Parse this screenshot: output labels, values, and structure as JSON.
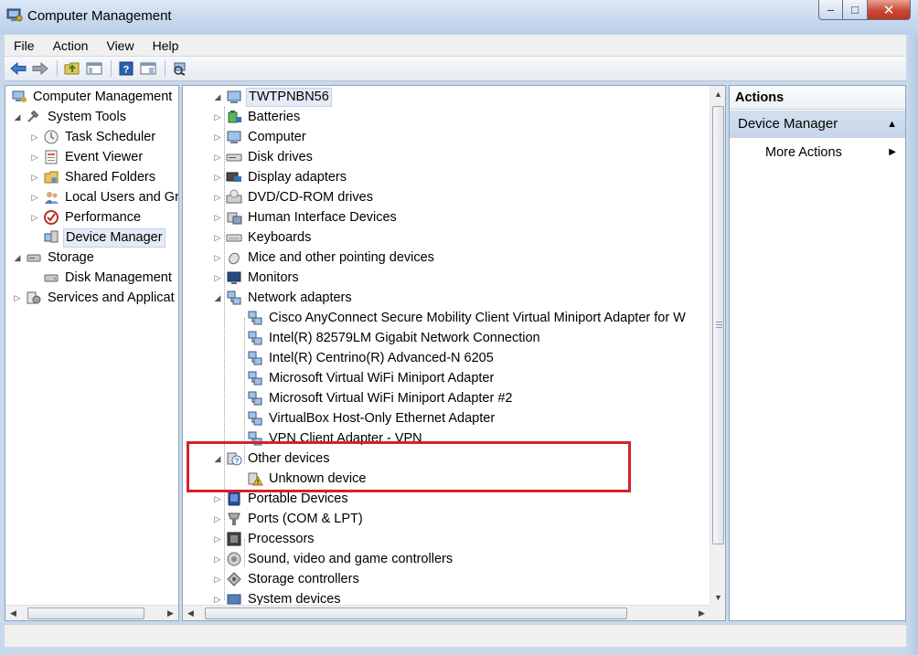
{
  "window": {
    "title": "Computer Management",
    "controls": {
      "minimize": "–",
      "maximize": "□",
      "close": "✕"
    }
  },
  "menu": [
    "File",
    "Action",
    "View",
    "Help"
  ],
  "toolbar": [
    "back-icon",
    "forward-icon",
    "up-folder-icon",
    "show-hide-tree-icon",
    "help-icon",
    "properties-icon",
    "scan-hardware-icon"
  ],
  "left_tree": [
    {
      "label": "Computer Management",
      "level": 0,
      "toggle": "",
      "icon": "computer-management-icon"
    },
    {
      "label": "System Tools",
      "level": 1,
      "toggle": "◢",
      "icon": "system-tools-icon"
    },
    {
      "label": "Task Scheduler",
      "level": 2,
      "toggle": "▷",
      "icon": "clock-icon"
    },
    {
      "label": "Event Viewer",
      "level": 2,
      "toggle": "▷",
      "icon": "event-viewer-icon"
    },
    {
      "label": "Shared Folders",
      "level": 2,
      "toggle": "▷",
      "icon": "shared-folder-icon"
    },
    {
      "label": "Local Users and Gr",
      "level": 2,
      "toggle": "▷",
      "icon": "users-icon"
    },
    {
      "label": "Performance",
      "level": 2,
      "toggle": "▷",
      "icon": "performance-icon"
    },
    {
      "label": "Device Manager",
      "level": 2,
      "toggle": "",
      "icon": "device-manager-icon",
      "selected": true
    },
    {
      "label": "Storage",
      "level": 1,
      "toggle": "◢",
      "icon": "storage-icon"
    },
    {
      "label": "Disk Management",
      "level": 2,
      "toggle": "",
      "icon": "disk-icon"
    },
    {
      "label": "Services and Applicat",
      "level": 1,
      "toggle": "▷",
      "icon": "services-icon"
    }
  ],
  "device_tree": {
    "root": "TWTPNBN56",
    "items": [
      {
        "label": "Batteries",
        "level": 1,
        "toggle": "▷",
        "icon": "battery-icon"
      },
      {
        "label": "Computer",
        "level": 1,
        "toggle": "▷",
        "icon": "computer-icon"
      },
      {
        "label": "Disk drives",
        "level": 1,
        "toggle": "▷",
        "icon": "disk-drive-icon"
      },
      {
        "label": "Display adapters",
        "level": 1,
        "toggle": "▷",
        "icon": "display-adapter-icon"
      },
      {
        "label": "DVD/CD-ROM drives",
        "level": 1,
        "toggle": "▷",
        "icon": "dvd-icon"
      },
      {
        "label": "Human Interface Devices",
        "level": 1,
        "toggle": "▷",
        "icon": "hid-icon"
      },
      {
        "label": "Keyboards",
        "level": 1,
        "toggle": "▷",
        "icon": "keyboard-icon"
      },
      {
        "label": "Mice and other pointing devices",
        "level": 1,
        "toggle": "▷",
        "icon": "mouse-icon"
      },
      {
        "label": "Monitors",
        "level": 1,
        "toggle": "▷",
        "icon": "monitor-icon"
      },
      {
        "label": "Network adapters",
        "level": 1,
        "toggle": "◢",
        "icon": "network-adapter-icon"
      },
      {
        "label": "Cisco AnyConnect Secure Mobility Client Virtual Miniport Adapter for W",
        "level": 2,
        "toggle": "",
        "icon": "network-adapter-icon"
      },
      {
        "label": "Intel(R) 82579LM Gigabit Network Connection",
        "level": 2,
        "toggle": "",
        "icon": "network-adapter-icon"
      },
      {
        "label": "Intel(R) Centrino(R) Advanced-N 6205",
        "level": 2,
        "toggle": "",
        "icon": "network-adapter-icon"
      },
      {
        "label": "Microsoft Virtual WiFi Miniport Adapter",
        "level": 2,
        "toggle": "",
        "icon": "network-adapter-icon"
      },
      {
        "label": "Microsoft Virtual WiFi Miniport Adapter #2",
        "level": 2,
        "toggle": "",
        "icon": "network-adapter-icon"
      },
      {
        "label": "VirtualBox Host-Only Ethernet Adapter",
        "level": 2,
        "toggle": "",
        "icon": "network-adapter-icon"
      },
      {
        "label": "VPN Client Adapter - VPN",
        "level": 2,
        "toggle": "",
        "icon": "network-adapter-icon"
      },
      {
        "label": "Other devices",
        "level": 1,
        "toggle": "◢",
        "icon": "other-devices-icon"
      },
      {
        "label": "Unknown device",
        "level": 2,
        "toggle": "",
        "icon": "unknown-device-warning-icon"
      },
      {
        "label": "Portable Devices",
        "level": 1,
        "toggle": "▷",
        "icon": "portable-device-icon"
      },
      {
        "label": "Ports (COM & LPT)",
        "level": 1,
        "toggle": "▷",
        "icon": "port-icon"
      },
      {
        "label": "Processors",
        "level": 1,
        "toggle": "▷",
        "icon": "processor-icon"
      },
      {
        "label": "Sound, video and game controllers",
        "level": 1,
        "toggle": "▷",
        "icon": "sound-icon"
      },
      {
        "label": "Storage controllers",
        "level": 1,
        "toggle": "▷",
        "icon": "storage-controller-icon"
      },
      {
        "label": "System devices",
        "level": 1,
        "toggle": "▷",
        "icon": "system-devices-icon"
      }
    ]
  },
  "actions": {
    "title": "Actions",
    "group": "Device Manager",
    "group_caret": "▲",
    "more": "More Actions",
    "more_caret": "▶"
  },
  "colors": {
    "highlight": "#d2232a",
    "selection": "#e3ebf5",
    "action_group": "#c6d6ea"
  }
}
